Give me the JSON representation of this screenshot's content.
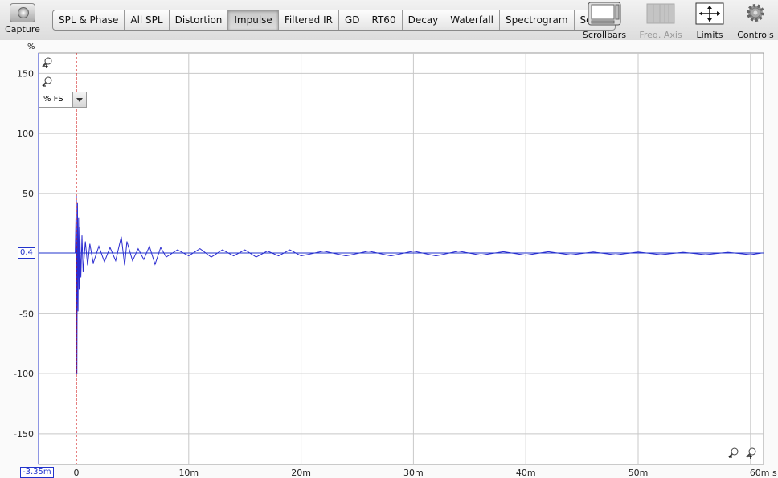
{
  "toolbar": {
    "capture_label": "Capture",
    "tabs": [
      "SPL & Phase",
      "All SPL",
      "Distortion",
      "Impulse",
      "Filtered IR",
      "GD",
      "RT60",
      "Decay",
      "Waterfall",
      "Spectrogram",
      "Scope"
    ],
    "active_tab": "Impulse",
    "scrollbars_label": "Scrollbars",
    "freq_axis_label": "Freq. Axis",
    "limits_label": "Limits",
    "controls_label": "Controls"
  },
  "graph": {
    "y_unit": "%",
    "unit_selector": "% FS",
    "y_ticks": [
      "150",
      "100",
      "50",
      "0.4",
      "-50",
      "-100",
      "-150"
    ],
    "x_ticks": [
      "0",
      "10m",
      "20m",
      "30m",
      "40m",
      "50m",
      "60m s"
    ],
    "cursor_x_readout": "-3.35m",
    "cursor_y_readout": "0.4",
    "colors": {
      "trace": "#2b2bd0",
      "cursor": "#2233cc",
      "marker": "#cc0000",
      "grid": "#c8c8c8"
    }
  },
  "chart_data": {
    "type": "line",
    "xlabel": "s",
    "ylabel": "%",
    "xlim": [
      -3.35,
      61
    ],
    "ylim": [
      -160,
      160
    ],
    "grid": true,
    "series": [
      {
        "x": [
          -3.35,
          -0.1,
          0,
          0.05,
          0.1,
          0.15,
          0.2,
          0.25,
          0.3,
          0.4,
          0.5,
          0.6,
          0.8,
          1.0,
          1.2,
          1.5,
          2.0,
          2.5,
          3.0,
          3.5,
          4.0,
          4.3,
          4.5,
          5.0,
          5.5,
          6.0,
          6.5,
          7.0,
          7.5,
          8.0,
          9.0,
          10,
          11,
          12,
          13,
          14,
          15,
          16,
          17,
          18,
          19,
          20,
          22,
          24,
          26,
          28,
          30,
          32,
          34,
          36,
          38,
          40,
          42,
          44,
          46,
          48,
          50,
          52,
          54,
          56,
          58,
          60,
          61
        ],
        "y": [
          0.4,
          0.4,
          48,
          -100,
          42,
          -48,
          30,
          -30,
          22,
          -20,
          15,
          -15,
          10,
          -10,
          8,
          -8,
          6,
          -7,
          5,
          -6,
          14,
          -10,
          10,
          -6,
          4,
          -5,
          6,
          -9,
          5,
          -3,
          3,
          -2,
          4,
          -3,
          3,
          -2,
          3,
          -3,
          2,
          -2,
          3,
          -2,
          2,
          -2,
          2,
          -2,
          2,
          -2,
          2,
          -1.5,
          1.5,
          -1.5,
          1.5,
          -1.2,
          1.2,
          -1.2,
          1.2,
          -1,
          1,
          -1,
          1,
          -1,
          0.4
        ]
      }
    ]
  }
}
